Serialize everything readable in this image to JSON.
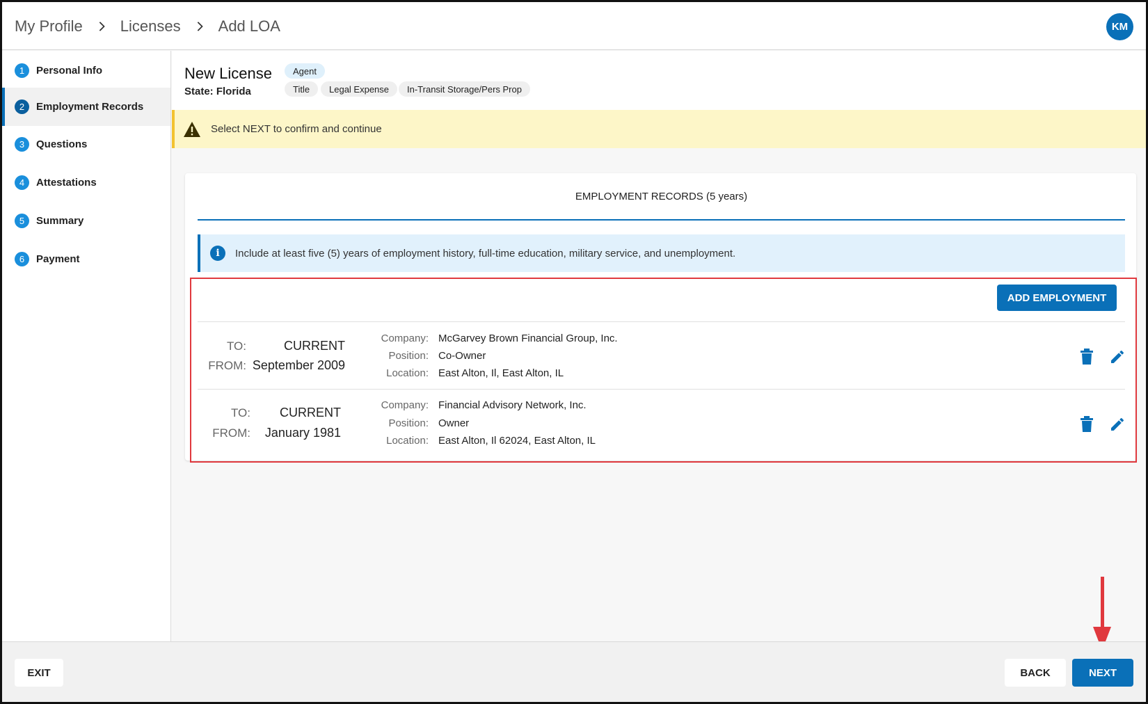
{
  "header": {
    "breadcrumbs": [
      "My Profile",
      "Licenses",
      "Add LOA"
    ],
    "avatar_initials": "KM"
  },
  "sidebar": {
    "steps": [
      {
        "num": "1",
        "label": "Personal Info"
      },
      {
        "num": "2",
        "label": "Employment Records"
      },
      {
        "num": "3",
        "label": "Questions"
      },
      {
        "num": "4",
        "label": "Attestations"
      },
      {
        "num": "5",
        "label": "Summary"
      },
      {
        "num": "6",
        "label": "Payment"
      }
    ],
    "active_step": "2"
  },
  "license": {
    "title": "New License",
    "state": "State: Florida",
    "type_chip": "Agent",
    "loa_chips": [
      "Title",
      "Legal Expense",
      "In-Transit Storage/Pers Prop"
    ]
  },
  "warning": {
    "text": "Select NEXT to confirm and continue"
  },
  "records": {
    "title": "EMPLOYMENT RECORDS (5 years)",
    "info_icon": "i",
    "info_text": "Include at least five (5) years of employment history, full-time education, military service, and unemployment.",
    "add_button": "ADD EMPLOYMENT",
    "labels": {
      "to": "TO:",
      "from": "FROM:",
      "company": "Company:",
      "position": "Position:",
      "location": "Location:"
    },
    "items": [
      {
        "to": "CURRENT",
        "from": "September 2009",
        "company": "McGarvey Brown Financial Group, Inc.",
        "position": "Co-Owner",
        "location": "East Alton, Il, East Alton, IL"
      },
      {
        "to": "CURRENT",
        "from": "January 1981",
        "company": "Financial Advisory Network, Inc.",
        "position": "Owner",
        "location": "East Alton, Il 62024, East Alton, IL"
      }
    ]
  },
  "footer": {
    "exit": "EXIT",
    "back": "BACK",
    "next": "NEXT"
  },
  "colors": {
    "primary": "#0a70b8",
    "highlight": "#e0393e",
    "warning_bg": "#fdf6c8",
    "info_bg": "#e1f1fc"
  }
}
